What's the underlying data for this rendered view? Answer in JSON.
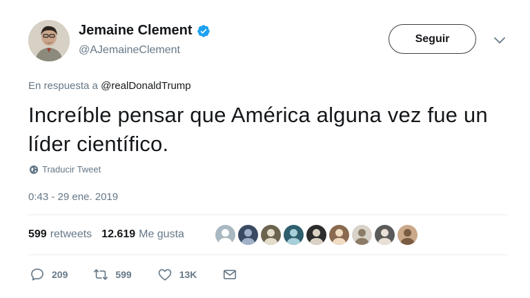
{
  "author": {
    "display_name": "Jemaine Clement",
    "handle": "@AJemaineClement",
    "verified": true
  },
  "follow_label": "Seguir",
  "reply_context": {
    "prefix": "En respuesta a",
    "mention": "@realDonaldTrump"
  },
  "text": "Increíble pensar que América alguna vez fue un líder científico.",
  "translate_label": "Traducir Tweet",
  "timestamp": "0:43 - 29 ene. 2019",
  "stats": {
    "retweets_count": "599",
    "retweets_label": "retweets",
    "likes_count": "12.619",
    "likes_label": "Me gusta"
  },
  "liker_avatars": [
    {
      "bg": "#aab8c2",
      "fg": "#ffffff"
    },
    {
      "bg": "#3a4a63",
      "fg": "#9fb0c8"
    },
    {
      "bg": "#6d6450",
      "fg": "#e3dccb"
    },
    {
      "bg": "#2f5f6e",
      "fg": "#a8d0da"
    },
    {
      "bg": "#2c2c2c",
      "fg": "#d9d2c4"
    },
    {
      "bg": "#8a6a4f",
      "fg": "#f0dcc2"
    },
    {
      "bg": "#d8d2c9",
      "fg": "#8c7b66"
    },
    {
      "bg": "#5a5a5a",
      "fg": "#e8e0d6"
    },
    {
      "bg": "#c9a98a",
      "fg": "#7a5c43"
    }
  ],
  "actions": {
    "reply_count": "209",
    "retweet_count": "599",
    "like_count": "13K"
  },
  "colors": {
    "verified": "#1da1f2",
    "muted": "#657786",
    "text": "#14171a",
    "divider": "#e6ecf0"
  },
  "icons": [
    "verified-badge-icon",
    "chevron-down-icon",
    "globe-icon",
    "reply-icon",
    "retweet-icon",
    "like-icon",
    "message-icon"
  ]
}
